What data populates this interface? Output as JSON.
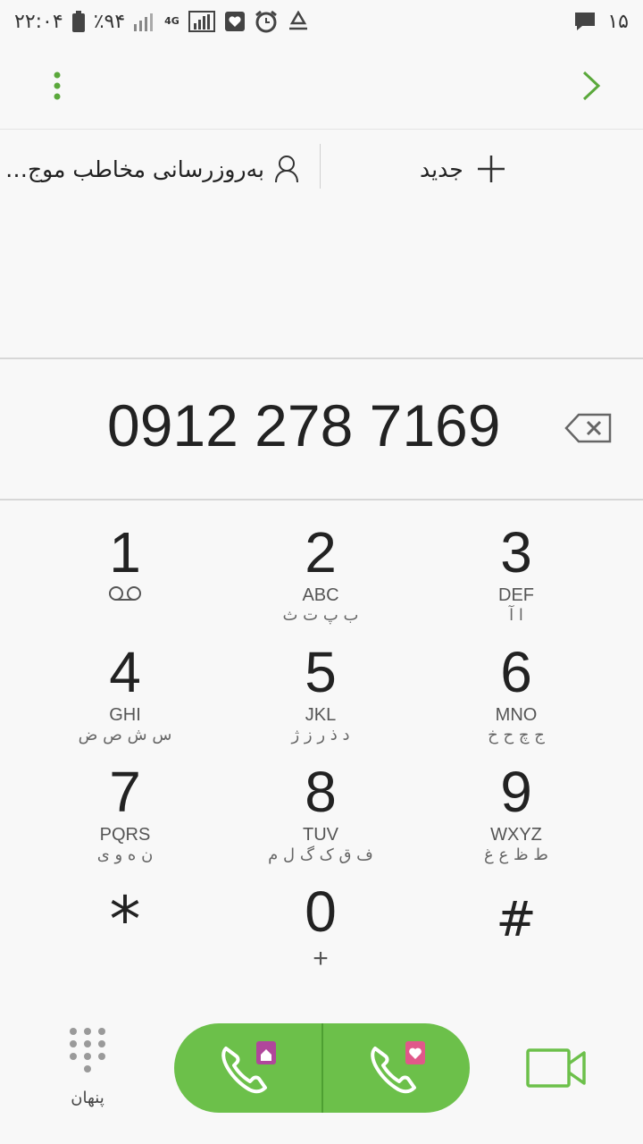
{
  "status_bar": {
    "time": "۲۲:۰۴",
    "battery": "٪۹۴",
    "network": "4G",
    "notification_count": "۱۵"
  },
  "actions": {
    "update_contact_label": "بەروزرسانی مخاطب موج…",
    "new_contact_label": "جدید"
  },
  "dialed_number": "0912 278 7169",
  "keypad": [
    {
      "digit": "1",
      "letters": "",
      "persian": ""
    },
    {
      "digit": "2",
      "letters": "ABC",
      "persian": "ب پ ت ث"
    },
    {
      "digit": "3",
      "letters": "DEF",
      "persian": "ا آ"
    },
    {
      "digit": "4",
      "letters": "GHI",
      "persian": "س ش ص ض"
    },
    {
      "digit": "5",
      "letters": "JKL",
      "persian": "د ذ ر ز ژ"
    },
    {
      "digit": "6",
      "letters": "MNO",
      "persian": "ج چ ح خ"
    },
    {
      "digit": "7",
      "letters": "PQRS",
      "persian": "ن ه و ی"
    },
    {
      "digit": "8",
      "letters": "TUV",
      "persian": "ف ق ک گ ل م"
    },
    {
      "digit": "9",
      "letters": "WXYZ",
      "persian": "ط ظ ع غ"
    },
    {
      "digit": "*",
      "letters": "",
      "persian": ""
    },
    {
      "digit": "0",
      "letters": "+",
      "persian": ""
    },
    {
      "digit": "#",
      "letters": "",
      "persian": ""
    }
  ],
  "bottom": {
    "hide_keypad_label": "پنهان"
  },
  "colors": {
    "accent_green": "#6cc04a",
    "sim1_badge": "#b0479b",
    "sim2_badge": "#e0588a"
  }
}
